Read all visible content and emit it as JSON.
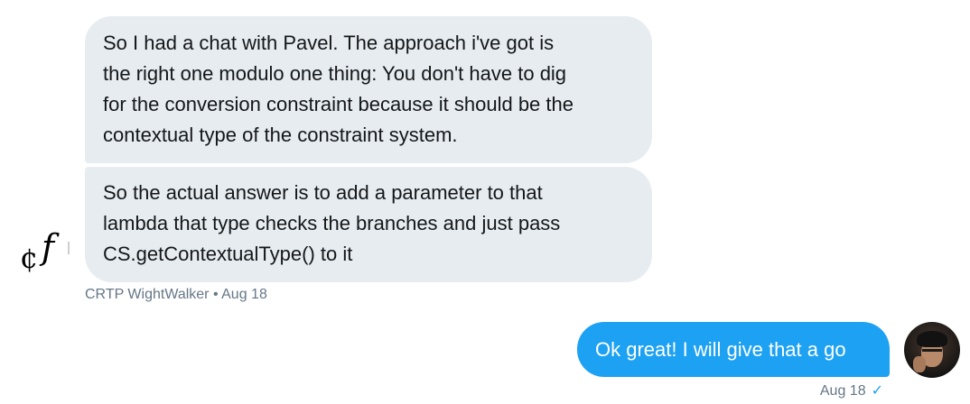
{
  "messages_in": [
    {
      "lines": [
        "So I had a chat with Pavel.  The approach i've got is",
        "the right one modulo one thing: You don't have to dig",
        "for the conversion constraint because it should be the",
        "contextual type of the constraint system."
      ]
    },
    {
      "lines": [
        "So the actual answer is to add a parameter to that",
        "lambda that type checks the branches and just pass",
        "CS.getContextualType() to it"
      ]
    }
  ],
  "sender": {
    "name": "CRTP WightWalker",
    "separator": " • ",
    "date": "Aug 18",
    "avatar_glyph_1": "¢",
    "avatar_glyph_2": "f"
  },
  "message_out": {
    "text": "Ok great! I will give that a go",
    "date": "Aug 18",
    "status_icon": "✓"
  },
  "colors": {
    "incoming_bubble": "#e6ecf0",
    "outgoing_bubble": "#1da1f2",
    "meta_text": "#657786"
  }
}
